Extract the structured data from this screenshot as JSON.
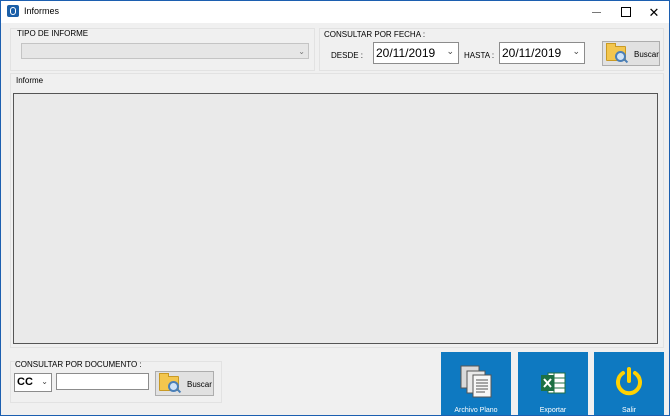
{
  "window": {
    "title": "Informes",
    "controls": {
      "minimize": "minimize",
      "maximize": "maximize",
      "close": "close"
    }
  },
  "tipo_informe": {
    "label": "TIPO DE INFORME",
    "value": ""
  },
  "consultar_fecha": {
    "label": "CONSULTAR POR FECHA :",
    "desde_label": "DESDE :",
    "desde_value": "20/11/2019",
    "hasta_label": "HASTA :",
    "hasta_value": "20/11/2019",
    "buscar_label": "Buscar"
  },
  "informe": {
    "label": "Informe"
  },
  "consultar_documento": {
    "label": "CONSULTAR POR DOCUMENTO :",
    "doc_type": "CC",
    "doc_number": "",
    "buscar_label": "Buscar"
  },
  "tiles": {
    "archivo_plano": "Archivo Plano",
    "exportar": "Exportar",
    "salir": "Salir"
  },
  "colors": {
    "tile_background": "#0e79c1",
    "window_border": "#1c5fb0",
    "excel_green": "#1d7044",
    "power_yellow": "#ffd100"
  },
  "icons": {
    "app": "informes-app-icon",
    "search": "folder-search-icon",
    "archivo_plano": "documents-icon",
    "exportar": "excel-icon",
    "salir": "power-icon"
  }
}
